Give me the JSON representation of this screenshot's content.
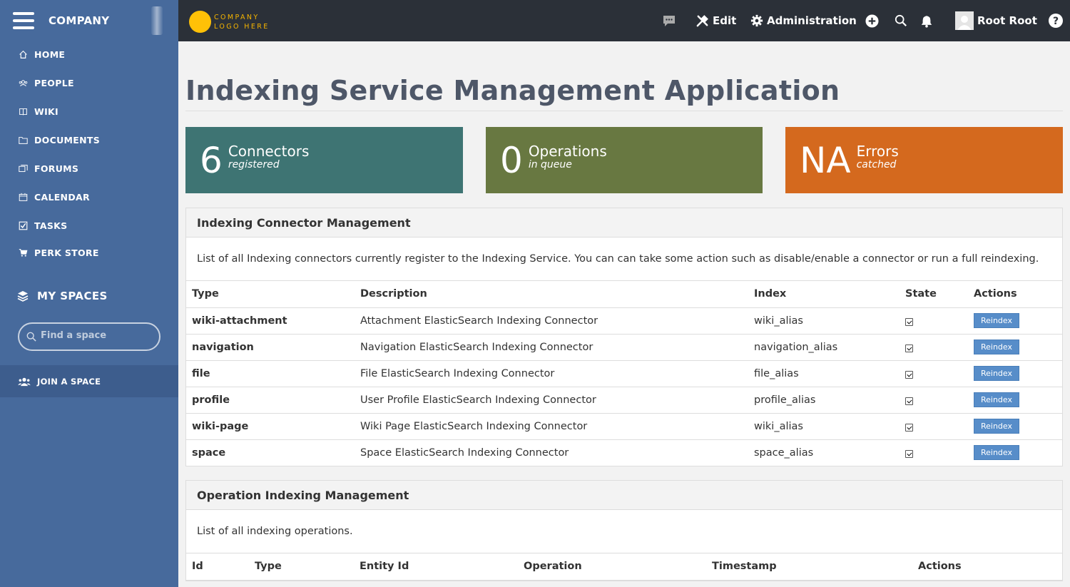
{
  "sidebar": {
    "company": "COMPANY",
    "items": [
      {
        "label": "HOME",
        "icon": "home-icon"
      },
      {
        "label": "PEOPLE",
        "icon": "people-icon"
      },
      {
        "label": "WIKI",
        "icon": "book-icon"
      },
      {
        "label": "DOCUMENTS",
        "icon": "folder-icon"
      },
      {
        "label": "FORUMS",
        "icon": "forums-icon"
      },
      {
        "label": "CALENDAR",
        "icon": "calendar-icon"
      },
      {
        "label": "TASKS",
        "icon": "task-check-icon"
      },
      {
        "label": "PERK STORE",
        "icon": "cart-icon"
      }
    ],
    "my_spaces": "MY SPACES",
    "find_space_placeholder": "Find a space",
    "join_space": "JOIN A SPACE"
  },
  "topbar": {
    "logo_line1": "COMPANY",
    "logo_line2": "LOGO HERE",
    "edit": "Edit",
    "administration": "Administration",
    "user": "Root Root"
  },
  "page": {
    "title": "Indexing Service Management Application"
  },
  "stats": [
    {
      "value": "6",
      "label": "Connectors",
      "sub": "registered",
      "color": "#3e7473"
    },
    {
      "value": "0",
      "label": "Operations",
      "sub": "in queue",
      "color": "#687841"
    },
    {
      "value": "NA",
      "label": "Errors",
      "sub": "catched",
      "color": "#d4691e"
    }
  ],
  "connectors": {
    "title": "Indexing Connector Management",
    "description": "List of all Indexing connectors currently register to the Indexing Service. You can can take some action such as disable/enable a connector or run a full reindexing.",
    "columns": [
      "Type",
      "Description",
      "Index",
      "State",
      "Actions"
    ],
    "action_label": "Reindex",
    "rows": [
      {
        "type": "wiki-attachment",
        "description": "Attachment ElasticSearch Indexing Connector",
        "index": "wiki_alias",
        "enabled": true
      },
      {
        "type": "navigation",
        "description": "Navigation ElasticSearch Indexing Connector",
        "index": "navigation_alias",
        "enabled": true
      },
      {
        "type": "file",
        "description": "File ElasticSearch Indexing Connector",
        "index": "file_alias",
        "enabled": true
      },
      {
        "type": "profile",
        "description": "User Profile ElasticSearch Indexing Connector",
        "index": "profile_alias",
        "enabled": true
      },
      {
        "type": "wiki-page",
        "description": "Wiki Page ElasticSearch Indexing Connector",
        "index": "wiki_alias",
        "enabled": true
      },
      {
        "type": "space",
        "description": "Space ElasticSearch Indexing Connector",
        "index": "space_alias",
        "enabled": true
      }
    ]
  },
  "operations": {
    "title": "Operation Indexing Management",
    "description": "List of all indexing operations.",
    "columns": [
      "Id",
      "Type",
      "Entity Id",
      "Operation",
      "Timestamp",
      "Actions"
    ]
  }
}
